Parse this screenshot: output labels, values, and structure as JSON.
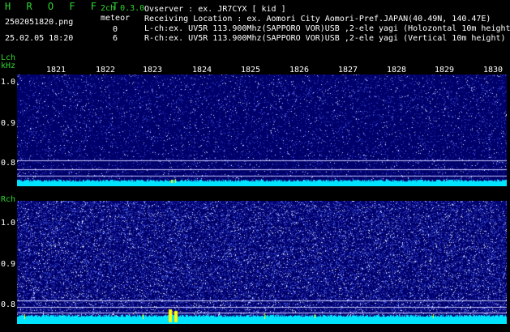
{
  "header": {
    "app_name": "H R O F F T",
    "version": "2ch 0.3.0",
    "filename": "2502051820.png",
    "meteor_label": "meteor",
    "timestamp": "25.02.05 18:20",
    "lch_meteor_count": "0",
    "rch_meteor_count": "6",
    "info_lines": [
      "Ovserver            : ex. JR7CYX [ kid ]",
      "Receiving Location : ex. Aomori City Aomori-Pref.JAPAN(40.49N, 140.47E)",
      "L-ch:ex. UV5R 113.900Mhz(SAPPORO VOR)USB ,2-ele yagi (Holozontal 10m height)",
      "R-ch:ex. UV5R 113.900Mhz(SAPPORO VOR)USB ,2-ele yagi (Vertical 10m height)"
    ]
  },
  "time_ticks": [
    "1821",
    "1822",
    "1823",
    "1824",
    "1825",
    "1826",
    "1827",
    "1828",
    "1829",
    "1830"
  ],
  "lch": {
    "label": "Lch",
    "unit": "kHz",
    "freq_ticks": [
      "1.0",
      "0.9",
      "0.8"
    ]
  },
  "rch": {
    "label": "Rch",
    "freq_ticks": [
      "1.0",
      "0.9",
      "0.8"
    ]
  },
  "colors": {
    "background": "#000000",
    "spectrogram_base": "#00006a",
    "noise_band": "#00e5ff",
    "meteor": "#ffff00",
    "label_green": "#2fd62f"
  }
}
